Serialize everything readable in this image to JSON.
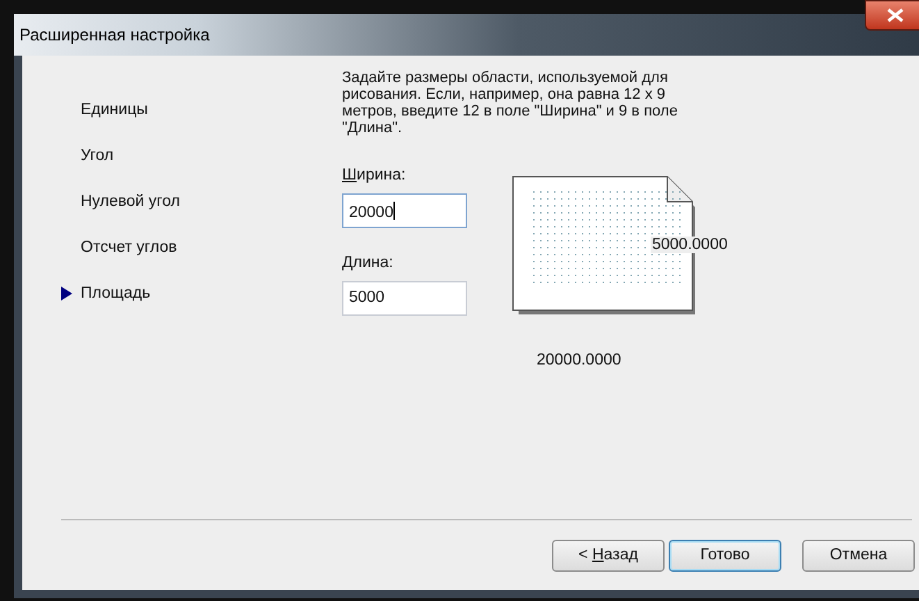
{
  "window": {
    "title": "Расширенная настройка"
  },
  "steps": [
    {
      "label": "Единицы",
      "selected": false
    },
    {
      "label": "Угол",
      "selected": false
    },
    {
      "label": "Нулевой угол",
      "selected": false
    },
    {
      "label": "Отсчет углов",
      "selected": false
    },
    {
      "label": "Площадь",
      "selected": true
    }
  ],
  "description": "Задайте размеры области, используемой для рисования. Если, например, она равна 12 x 9 метров, введите 12 в поле \"Ширина\" и 9 в поле \"Длина\".",
  "fields": [
    {
      "label": {
        "key": "Ш",
        "after": "ирина:"
      },
      "value": "20000",
      "focused": true
    },
    {
      "label": {
        "key": "Д",
        "after": "лина:"
      },
      "value": "5000",
      "focused": false
    }
  ],
  "preview": {
    "length_label": "5000.0000",
    "width_label": "20000.0000"
  },
  "buttons": [
    {
      "label": {
        "before": "< ",
        "key": "Н",
        "after": "азад"
      },
      "default": false
    },
    {
      "label": {
        "before": "Готово"
      },
      "default": true
    },
    {
      "label": {
        "before": "Отмена"
      },
      "default": false
    }
  ]
}
